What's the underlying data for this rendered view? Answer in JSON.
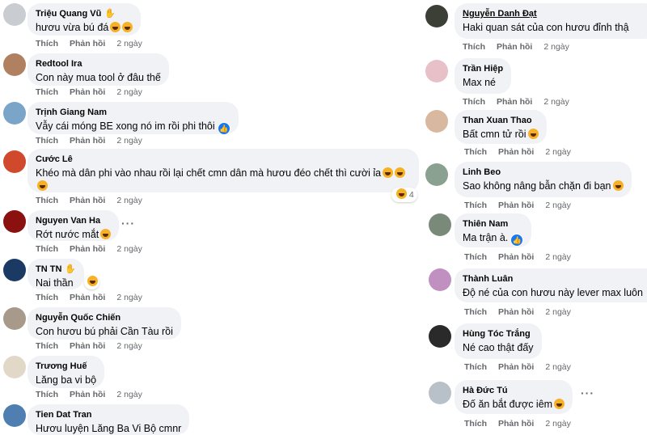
{
  "actions": {
    "like": "Thích",
    "reply": "Phản hồi"
  },
  "left": [
    {
      "name": "Triệu Quang Vũ",
      "text": "hươu vừa bú đá",
      "time": "2 ngày"
    },
    {
      "name": "Redtool Ira",
      "text": "Con này mua tool ở đâu thế",
      "time": "2 ngày"
    },
    {
      "name": "Trịnh Giang Nam",
      "text": "Vẫy cái móng BE xong nó im rồi phi thôi",
      "time": "2 ngày"
    },
    {
      "name": "Cước Lê",
      "text": "Khéo mà dân phi vào nhau rồi lại chết cmn dân mà hươu đéo chết thì cười ỉa",
      "time": "2 ngày",
      "reaction_count": "4"
    },
    {
      "name": "Nguyen Van Ha",
      "text": "Rớt nước mắt",
      "time": "2 ngày"
    },
    {
      "name": "TN TN",
      "text": "Nai thần",
      "time": "2 ngày"
    },
    {
      "name": "Nguyễn Quốc Chiến",
      "text": "Con hươu bú phải Cần Tàu rồi",
      "time": "2 ngày"
    },
    {
      "name": "Trương Huế",
      "text": "Lăng ba vi bộ",
      "time": "2 ngày"
    },
    {
      "name": "Tien Dat Tran",
      "text": "Hươu luyện Lăng Ba Vi Bộ cmnr",
      "time": ""
    }
  ],
  "right": [
    {
      "name": "Nguyễn Danh Đạt",
      "text": "Haki quan sát của con hươu đỉnh thậ",
      "time": "2 ngày"
    },
    {
      "name": "Trần Hiệp",
      "text": "Max né",
      "time": "2 ngày"
    },
    {
      "name": "Than Xuan Thao",
      "text": "Bất cmn tử rồi",
      "time": "2 ngày"
    },
    {
      "name": "Linh Beo",
      "text": "Sao không nâng bẫn chặn đi bạn",
      "time": "2 ngày"
    },
    {
      "name": "Thiên Nam",
      "text": "Ma trận à.",
      "time": "2 ngày"
    },
    {
      "name": "Thành Luân",
      "text": "Độ né của con hươu này lever max luôn",
      "time": "2 ngày"
    },
    {
      "name": "Hùng Tóc Trắng",
      "text": "Né cao thật đấy",
      "time": "2 ngày"
    },
    {
      "name": "Hà Đức Tú",
      "text": "Đố ăn bắt được iêm",
      "time": "2 ngày"
    }
  ]
}
